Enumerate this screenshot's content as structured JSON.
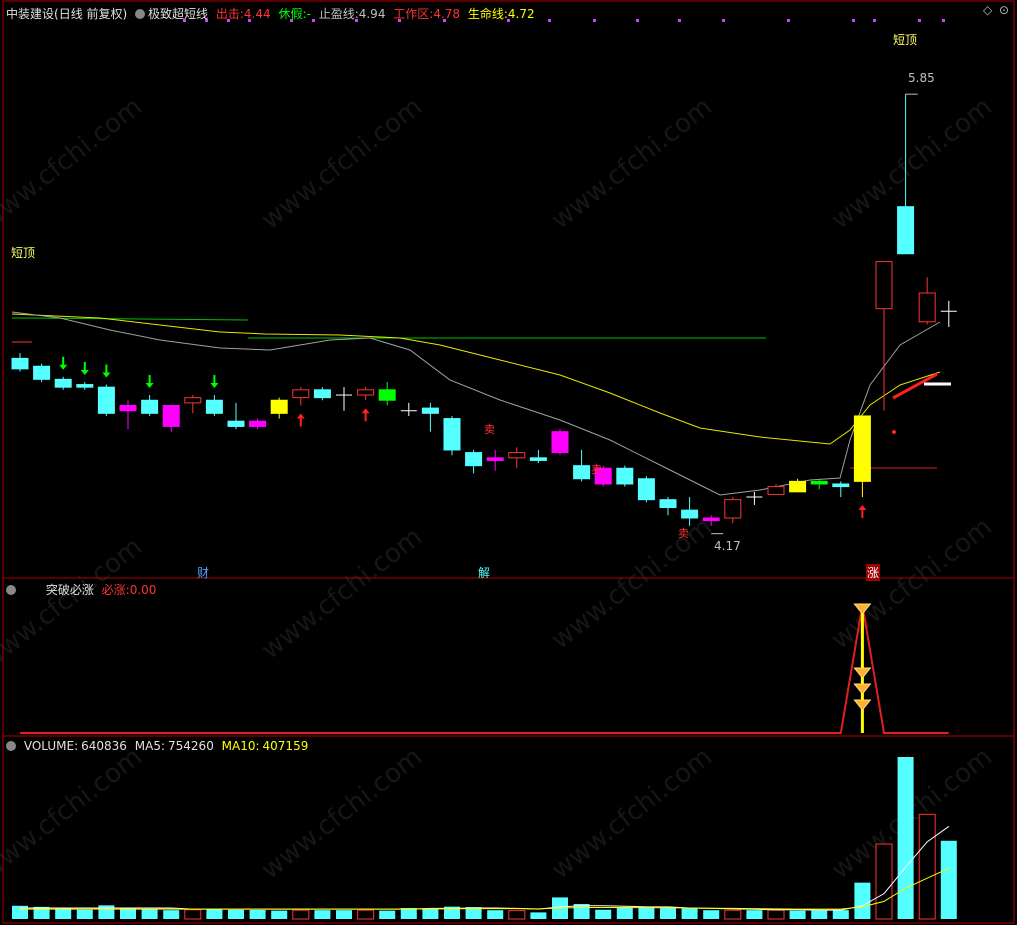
{
  "header": {
    "stock": "中装建设",
    "period": "(日线 前复权)",
    "indicator_name": "极致超短线",
    "chuji_label": "出击:",
    "chuji_value": "4.44",
    "xiujia_label": "休假:",
    "xiujia_value": "-",
    "zhiying_label": "止盈线:",
    "zhiying_value": "4.94",
    "gongzuo_label": "工作区:",
    "gongzuo_value": "4.78",
    "shengming_label": "生命线:",
    "shengming_value": "4.72"
  },
  "annotations": {
    "short_top_left": "短顶",
    "short_top_right": "短顶",
    "high_price": "5.85",
    "low_price": "4.17",
    "mark_cai": "财",
    "mark_jie": "解",
    "mark_zhang": "涨",
    "sell_mark": "卖"
  },
  "panel2": {
    "title": "突破必涨",
    "label": "必涨:",
    "value": "0.00"
  },
  "panel3": {
    "vol_label": "VOLUME:",
    "vol_value": "640836",
    "ma5_label": "MA5:",
    "ma5_value": "754260",
    "ma10_label": "MA10:",
    "ma10_value": "407159"
  },
  "watermark": "www.cfchi.com",
  "colors": {
    "up": "#ff3232",
    "down": "#54ffff",
    "magenta": "#ff00ff",
    "yellow": "#ffff00",
    "green": "#00ff00",
    "white": "#ffffff",
    "border": "#b00000"
  },
  "chart_data": [
    {
      "type": "candlestick",
      "title": "极致超短线",
      "ylim": [
        4.1,
        5.95
      ],
      "candles": [
        {
          "o": 4.84,
          "c": 4.8,
          "h": 4.86,
          "l": 4.79,
          "color": "down"
        },
        {
          "o": 4.81,
          "c": 4.76,
          "h": 4.82,
          "l": 4.75,
          "color": "down"
        },
        {
          "o": 4.76,
          "c": 4.73,
          "h": 4.77,
          "l": 4.72,
          "color": "down"
        },
        {
          "o": 4.74,
          "c": 4.73,
          "h": 4.75,
          "l": 4.72,
          "color": "down"
        },
        {
          "o": 4.73,
          "c": 4.63,
          "h": 4.74,
          "l": 4.62,
          "color": "down"
        },
        {
          "o": 4.66,
          "c": 4.64,
          "h": 4.68,
          "l": 4.57,
          "color": "magenta"
        },
        {
          "o": 4.68,
          "c": 4.63,
          "h": 4.7,
          "l": 4.62,
          "color": "down"
        },
        {
          "o": 4.66,
          "c": 4.58,
          "h": 4.66,
          "l": 4.56,
          "color": "magenta"
        },
        {
          "o": 4.67,
          "c": 4.69,
          "h": 4.7,
          "l": 4.63,
          "color": "up"
        },
        {
          "o": 4.68,
          "c": 4.63,
          "h": 4.7,
          "l": 4.62,
          "color": "down"
        },
        {
          "o": 4.6,
          "c": 4.58,
          "h": 4.67,
          "l": 4.57,
          "color": "down"
        },
        {
          "o": 4.6,
          "c": 4.58,
          "h": 4.61,
          "l": 4.57,
          "color": "magenta"
        },
        {
          "o": 4.63,
          "c": 4.68,
          "h": 4.69,
          "l": 4.61,
          "color": "yellow"
        },
        {
          "o": 4.69,
          "c": 4.72,
          "h": 4.73,
          "l": 4.66,
          "color": "up"
        },
        {
          "o": 4.72,
          "c": 4.69,
          "h": 4.73,
          "l": 4.68,
          "color": "down"
        },
        {
          "o": 4.7,
          "c": 4.7,
          "h": 4.73,
          "l": 4.64,
          "color": "white"
        },
        {
          "o": 4.7,
          "c": 4.72,
          "h": 4.73,
          "l": 4.68,
          "color": "up"
        },
        {
          "o": 4.68,
          "c": 4.72,
          "h": 4.75,
          "l": 4.66,
          "color": "green"
        },
        {
          "o": 4.64,
          "c": 4.64,
          "h": 4.67,
          "l": 4.62,
          "color": "white"
        },
        {
          "o": 4.65,
          "c": 4.63,
          "h": 4.67,
          "l": 4.56,
          "color": "down"
        },
        {
          "o": 4.61,
          "c": 4.49,
          "h": 4.62,
          "l": 4.47,
          "color": "down"
        },
        {
          "o": 4.48,
          "c": 4.43,
          "h": 4.49,
          "l": 4.4,
          "color": "down"
        },
        {
          "o": 4.46,
          "c": 4.45,
          "h": 4.49,
          "l": 4.41,
          "color": "magenta"
        },
        {
          "o": 4.46,
          "c": 4.48,
          "h": 4.5,
          "l": 4.42,
          "color": "up"
        },
        {
          "o": 4.46,
          "c": 4.45,
          "h": 4.49,
          "l": 4.44,
          "color": "down"
        },
        {
          "o": 4.56,
          "c": 4.48,
          "h": 4.57,
          "l": 4.47,
          "color": "magenta"
        },
        {
          "o": 4.43,
          "c": 4.38,
          "h": 4.49,
          "l": 4.37,
          "color": "down"
        },
        {
          "o": 4.42,
          "c": 4.36,
          "h": 4.43,
          "l": 4.35,
          "color": "magenta"
        },
        {
          "o": 4.42,
          "c": 4.36,
          "h": 4.43,
          "l": 4.35,
          "color": "down"
        },
        {
          "o": 4.38,
          "c": 4.3,
          "h": 4.39,
          "l": 4.29,
          "color": "down"
        },
        {
          "o": 4.3,
          "c": 4.27,
          "h": 4.31,
          "l": 4.24,
          "color": "down"
        },
        {
          "o": 4.26,
          "c": 4.23,
          "h": 4.31,
          "l": 4.2,
          "color": "down"
        },
        {
          "o": 4.23,
          "c": 4.22,
          "h": 4.24,
          "l": 4.2,
          "color": "magenta"
        },
        {
          "o": 4.23,
          "c": 4.3,
          "h": 4.31,
          "l": 4.21,
          "color": "up"
        },
        {
          "o": 4.31,
          "c": 4.31,
          "h": 4.33,
          "l": 4.28,
          "color": "white"
        },
        {
          "o": 4.32,
          "c": 4.35,
          "h": 4.36,
          "l": 4.32,
          "color": "up"
        },
        {
          "o": 4.33,
          "c": 4.37,
          "h": 4.38,
          "l": 4.33,
          "color": "yellow"
        },
        {
          "o": 4.36,
          "c": 4.37,
          "h": 4.38,
          "l": 4.34,
          "color": "green"
        },
        {
          "o": 4.36,
          "c": 4.35,
          "h": 4.37,
          "l": 4.31,
          "color": "down"
        },
        {
          "o": 4.37,
          "c": 4.62,
          "h": 4.62,
          "l": 4.31,
          "color": "yellow"
        },
        {
          "o": 5.03,
          "c": 5.21,
          "h": 5.21,
          "l": 4.64,
          "color": "up"
        },
        {
          "o": 5.24,
          "c": 5.42,
          "h": 5.85,
          "l": 5.24,
          "color": "down"
        },
        {
          "o": 4.98,
          "c": 5.09,
          "h": 5.15,
          "l": 4.97,
          "color": "up"
        },
        {
          "o": 5.02,
          "c": 5.02,
          "h": 5.06,
          "l": 4.96,
          "color": "white"
        }
      ],
      "signals": {
        "down_arrows": [
          2,
          3,
          4,
          6,
          9
        ],
        "up_arrows": [
          13,
          16,
          39
        ],
        "sell_marks": [
          22,
          27,
          31
        ]
      },
      "annotations": {
        "high": 5.85,
        "low": 4.17
      }
    },
    {
      "type": "line",
      "title": "突破必涨",
      "series": [
        {
          "name": "必涨",
          "values": [
            0,
            0,
            0,
            0,
            0,
            0,
            0,
            0,
            0,
            0,
            0,
            0,
            0,
            0,
            0,
            0,
            0,
            0,
            0,
            0,
            0,
            0,
            0,
            0,
            0,
            0,
            0,
            0,
            0,
            0,
            0,
            0,
            0,
            0,
            0,
            0,
            0,
            0,
            0,
            1,
            0,
            0,
            0,
            0
          ]
        }
      ]
    },
    {
      "type": "bar",
      "title": "VOLUME",
      "values": [
        60000,
        55000,
        48000,
        42000,
        62000,
        50000,
        45000,
        40000,
        42000,
        46000,
        42000,
        41000,
        38000,
        40000,
        40000,
        40000,
        40000,
        38000,
        50000,
        48000,
        56000,
        54000,
        40000,
        38000,
        30000,
        98000,
        68000,
        42000,
        52000,
        54000,
        52000,
        48000,
        40000,
        40000,
        40000,
        40000,
        38000,
        38000,
        40000,
        165000,
        340000,
        735000,
        475000,
        355000
      ],
      "ma5": [
        50000,
        50000,
        50000,
        50000,
        50000,
        50000,
        50000,
        50000,
        45000,
        45000,
        45000,
        45000,
        45000,
        45000,
        45000,
        45000,
        45000,
        45000,
        45000,
        48000,
        48000,
        50000,
        50000,
        48000,
        45000,
        55000,
        60000,
        60000,
        58000,
        55000,
        55000,
        50000,
        48000,
        46000,
        44000,
        42000,
        42000,
        40000,
        40000,
        60000,
        115000,
        235000,
        350000,
        420000
      ],
      "ma10": [
        45000,
        45000,
        45000,
        45000,
        45000,
        45000,
        45000,
        45000,
        45000,
        45000,
        45000,
        45000,
        45000,
        45000,
        45000,
        45000,
        45000,
        45000,
        45000,
        46000,
        46000,
        47000,
        47000,
        47000,
        46000,
        50000,
        52000,
        52000,
        52000,
        51000,
        51000,
        50000,
        49000,
        48000,
        47000,
        46000,
        45000,
        45000,
        45000,
        55000,
        80000,
        140000,
        185000,
        230000
      ]
    }
  ]
}
